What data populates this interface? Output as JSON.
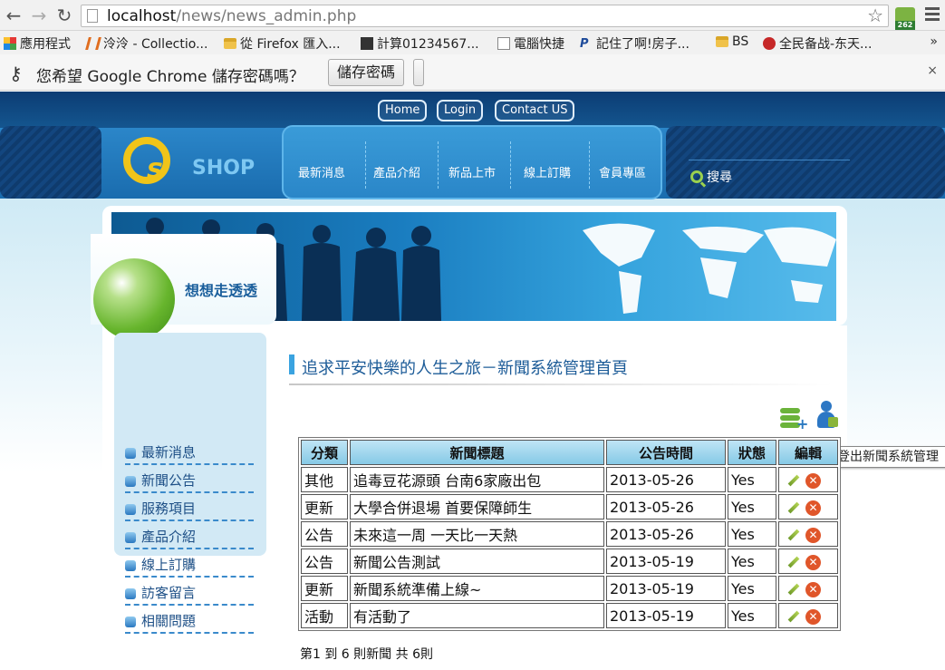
{
  "browser": {
    "url_host": "localhost",
    "url_path": "/news/news_admin.php",
    "ext_badge": "262",
    "bookmarks": [
      {
        "label": "應用程式",
        "icon": "apps-grid-icon"
      },
      {
        "label": "泠泠 - Collectio...",
        "icon": "bookmark-favicon-icon"
      },
      {
        "label": "從 Firefox 匯入...",
        "icon": "folder-icon"
      },
      {
        "label": "計算01234567...",
        "icon": "calculator-icon"
      },
      {
        "label": "電腦快捷",
        "icon": "page-icon"
      },
      {
        "label": "記住了啊!房子...",
        "icon": "p-icon"
      },
      {
        "label": "BS",
        "icon": "folder-icon"
      },
      {
        "label": "全民备战-东天...",
        "icon": "game-icon"
      }
    ],
    "more": "»",
    "password_prompt": {
      "message": "您希望 Google Chrome 儲存密碼嗎？",
      "save_button": "儲存密碼",
      "close": "×"
    }
  },
  "site": {
    "top_links": [
      "Home",
      "Login",
      "Contact US"
    ],
    "logo_text": "SHOP",
    "nav": [
      "最新消息",
      "產品介紹",
      "新品上市",
      "線上訂購",
      "會員專區"
    ],
    "search_label": "搜尋",
    "sidebar_title": "想想走透透",
    "sidebar_items": [
      "最新消息",
      "新聞公告",
      "服務項目",
      "產品介紹",
      "線上訂購",
      "訪客留言",
      "相關問題"
    ],
    "page_title": "追求平安快樂的人生之旅－新聞系統管理首頁",
    "tooltip": "登出新聞系統管理",
    "table": {
      "headers": [
        "分類",
        "新聞標題",
        "公告時間",
        "狀態",
        "編輯"
      ],
      "rows": [
        {
          "category": "其他",
          "title": "追毒豆花源頭 台南6家廠出包",
          "date": "2013-05-26",
          "status": "Yes"
        },
        {
          "category": "更新",
          "title": "大學合併退場 首要保障師生",
          "date": "2013-05-26",
          "status": "Yes"
        },
        {
          "category": "公告",
          "title": "未來這一周 一天比一天熱",
          "date": "2013-05-26",
          "status": "Yes"
        },
        {
          "category": "公告",
          "title": "新聞公告測試",
          "date": "2013-05-19",
          "status": "Yes"
        },
        {
          "category": "更新",
          "title": "新聞系統準備上線~",
          "date": "2013-05-19",
          "status": "Yes"
        },
        {
          "category": "活動",
          "title": "有活動了",
          "date": "2013-05-19",
          "status": "Yes"
        }
      ]
    },
    "summary": "第1 到 6 則新聞 共 6則"
  }
}
